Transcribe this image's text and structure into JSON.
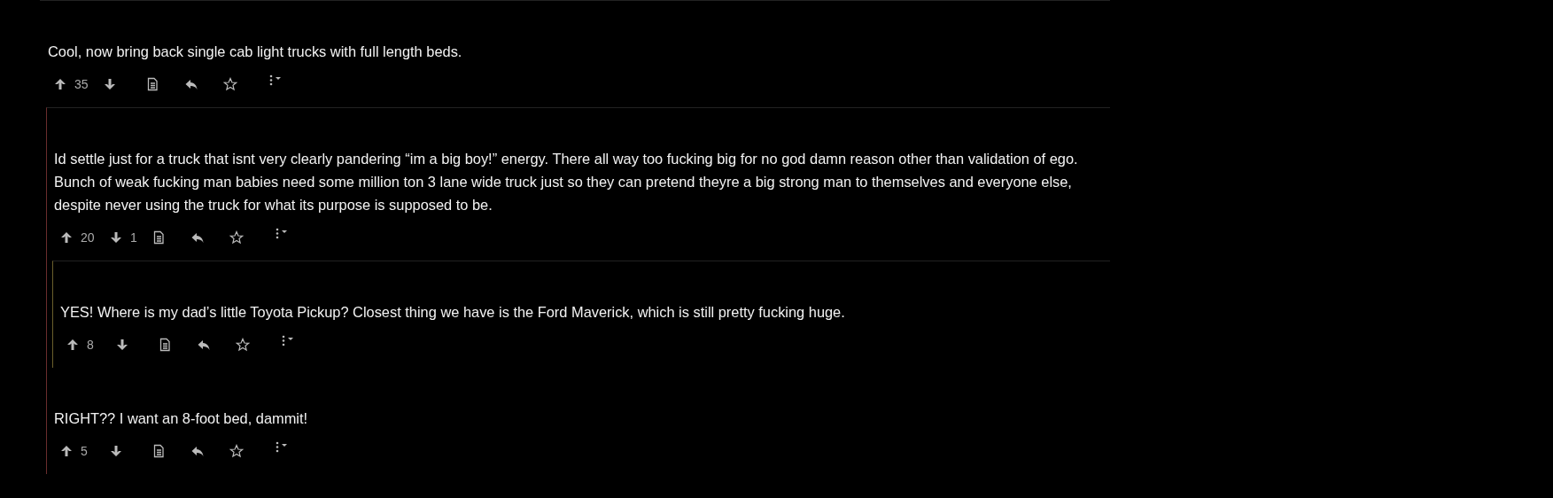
{
  "comments": [
    {
      "text": "Cool, now bring back single cab light trucks with full length beds.",
      "upvotes": "35",
      "children": [
        {
          "text": "Id settle just for a truck that isnt very clearly pandering “im a big boy!” energy. There all way too fucking big for no god damn reason other than validation of ego. Bunch of weak fucking man babies need some million ton 3 lane wide truck just so they can pretend theyre a big strong man to themselves and everyone else, despite never using the truck for what its purpose is supposed to be.",
          "upvotes": "20",
          "downvotes": "1",
          "children": [
            {
              "text": "YES! Where is my dad’s little Toyota Pickup? Closest thing we have is the Ford Maverick, which is still pretty fucking huge.",
              "upvotes": "8"
            }
          ]
        },
        {
          "text": "RIGHT?? I want an 8-foot bed, dammit!",
          "upvotes": "5"
        }
      ]
    }
  ]
}
